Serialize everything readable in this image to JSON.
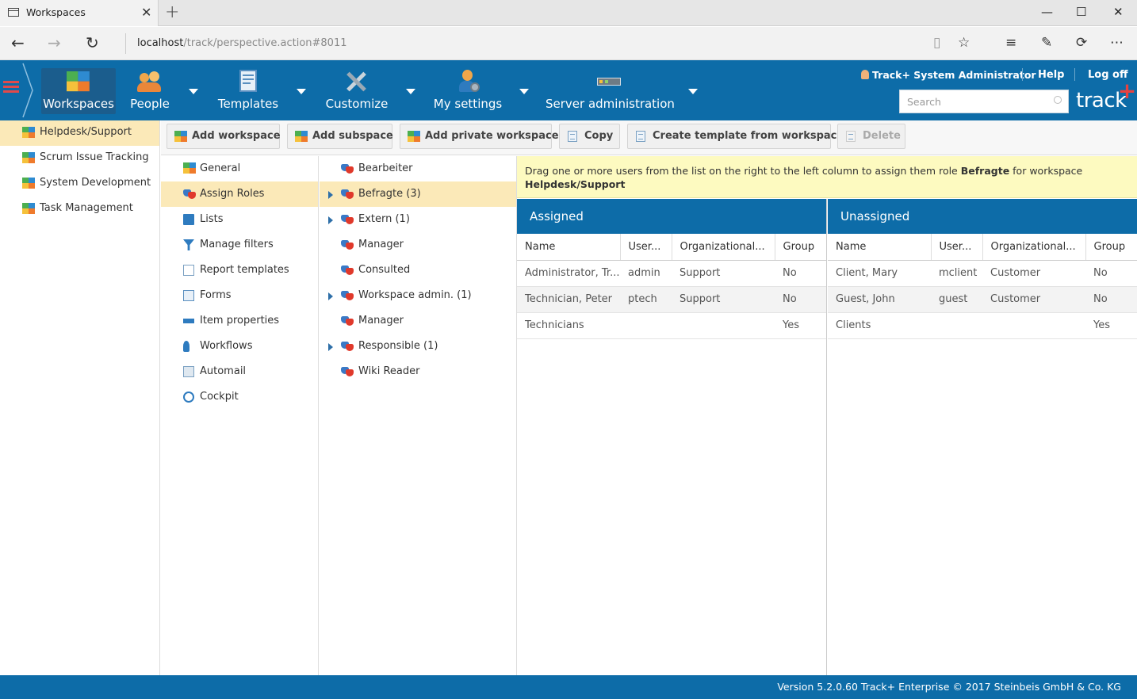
{
  "browser": {
    "tab_title": "Workspaces",
    "url_host": "localhost",
    "url_path": "/track/perspective.action#8011"
  },
  "header": {
    "nav": [
      {
        "label": "Workspaces",
        "icon": "workspaces-icon"
      },
      {
        "label": "People",
        "icon": "people-icon"
      },
      {
        "label": "Templates",
        "icon": "templates-icon"
      },
      {
        "label": "Customize",
        "icon": "customize-icon"
      },
      {
        "label": "My settings",
        "icon": "my-settings-icon"
      },
      {
        "label": "Server administration",
        "icon": "server-administration-icon"
      }
    ],
    "user": "Track+ System Administrator",
    "help": "Help",
    "logoff": "Log off",
    "search_placeholder": "Search",
    "logo": "track",
    "logo_plus": "+"
  },
  "workspaces": [
    {
      "label": "Helpdesk/Support",
      "selected": true
    },
    {
      "label": "Scrum Issue Tracking"
    },
    {
      "label": "System Development"
    },
    {
      "label": "Task Management"
    }
  ],
  "toolbar": {
    "add_workspace": "Add workspace",
    "add_subspace": "Add subspace",
    "add_private_workspace": "Add private workspace",
    "copy": "Copy",
    "create_template": "Create template from workspace",
    "delete": "Delete"
  },
  "settings_nav": [
    {
      "label": "General"
    },
    {
      "label": "Assign Roles",
      "selected": true
    },
    {
      "label": "Lists"
    },
    {
      "label": "Manage filters"
    },
    {
      "label": "Report templates"
    },
    {
      "label": "Forms"
    },
    {
      "label": "Item properties"
    },
    {
      "label": "Workflows"
    },
    {
      "label": "Automail"
    },
    {
      "label": "Cockpit"
    }
  ],
  "roles": [
    {
      "label": "Bearbeiter",
      "expandable": false
    },
    {
      "label": "Befragte (3)",
      "expandable": true,
      "selected": true
    },
    {
      "label": "Extern (1)",
      "expandable": true
    },
    {
      "label": "Manager",
      "expandable": false
    },
    {
      "label": "Consulted",
      "expandable": false
    },
    {
      "label": "Workspace admin. (1)",
      "expandable": true
    },
    {
      "label": "Manager",
      "expandable": false
    },
    {
      "label": "Responsible (1)",
      "expandable": true
    },
    {
      "label": "Wiki Reader",
      "expandable": false
    }
  ],
  "hint": {
    "prefix": "Drag one or more users from the list on the right to the left column to assign them role ",
    "role": "Befragte",
    "middle": " for workspace ",
    "workspace": "Helpdesk/Support"
  },
  "assigned": {
    "title": "Assigned",
    "columns": [
      "Name",
      "User...",
      "Organizational...",
      "Group"
    ],
    "rows": [
      [
        "Administrator, Tr...",
        "admin",
        "Support",
        "No"
      ],
      [
        "Technician, Peter",
        "ptech",
        "Support",
        "No"
      ],
      [
        "Technicians",
        "",
        "",
        "Yes"
      ]
    ]
  },
  "unassigned": {
    "title": "Unassigned",
    "columns": [
      "Name",
      "User...",
      "Organizational...",
      "Group"
    ],
    "rows": [
      [
        "Client, Mary",
        "mclient",
        "Customer",
        "No"
      ],
      [
        "Guest, John",
        "guest",
        "Customer",
        "No"
      ],
      [
        "Clients",
        "",
        "",
        "Yes"
      ]
    ]
  },
  "footer": "Version 5.2.0.60 Track+ Enterprise   © 2017 Steinbeis GmbH & Co. KG",
  "colors": {
    "header_blue": "#0d6ca8",
    "selection": "#fbe9b8",
    "hint_bg": "#fdfac0"
  }
}
